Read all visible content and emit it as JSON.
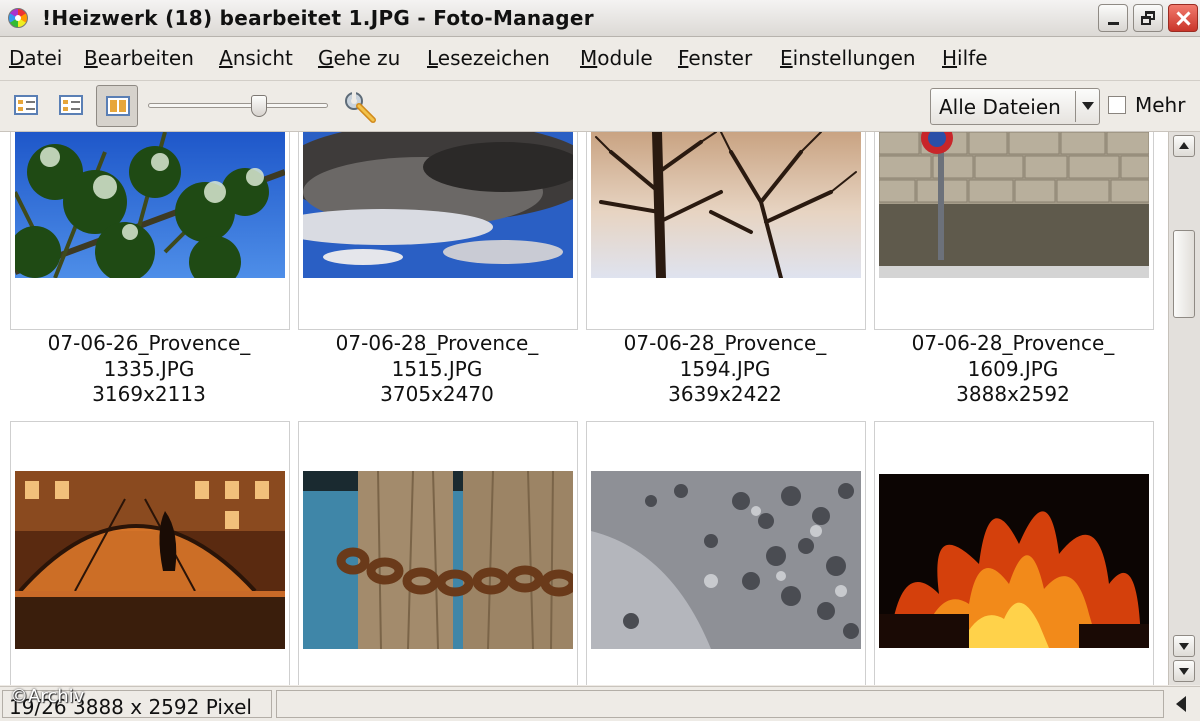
{
  "window": {
    "title": "!Heizwerk (18) bearbeitet 1.JPG - Foto-Manager",
    "app_icon": "color-wheel-icon",
    "controls": [
      "minimize-icon",
      "maximize-icon",
      "close-icon"
    ]
  },
  "menu": [
    "Datei",
    "Bearbeiten",
    "Ansicht",
    "Gehe zu",
    "Lesezeichen",
    "Module",
    "Fenster",
    "Einstellungen",
    "Hilfe"
  ],
  "toolbar": {
    "view_buttons": [
      "details-view-icon",
      "list-view-icon",
      "thumbnail-view-icon"
    ],
    "active_view": "thumbnail-view-icon",
    "zoom_slider_level": 0.62,
    "tool_icon": "wrench-icon",
    "filter_value": "Alle Dateien",
    "more_checkbox_label": "Mehr",
    "more_checked": false
  },
  "thumbnails": [
    {
      "line1": "07-06-26_Provence_",
      "line2": "1335.JPG",
      "dims": "3169x2113",
      "subject": "pine-branch"
    },
    {
      "line1": "07-06-28_Provence_",
      "line2": "1515.JPG",
      "dims": "3705x2470",
      "subject": "clouds"
    },
    {
      "line1": "07-06-28_Provence_",
      "line2": "1594.JPG",
      "dims": "3639x2422",
      "subject": "bare-tree"
    },
    {
      "line1": "07-06-28_Provence_",
      "line2": "1609.JPG",
      "dims": "3888x2592",
      "subject": "stone-wall"
    },
    {
      "subject": "glass-dome-night"
    },
    {
      "subject": "rusty-chain"
    },
    {
      "subject": "pebbles"
    },
    {
      "subject": "fire"
    }
  ],
  "statusbar": {
    "info": "19/26 3888 x 2592 Pixel",
    "watermark": "©Archiv"
  },
  "colors": {
    "window_bg": "#eeebe6",
    "content_bg": "#ffffff",
    "close_button": "#d9473b"
  }
}
